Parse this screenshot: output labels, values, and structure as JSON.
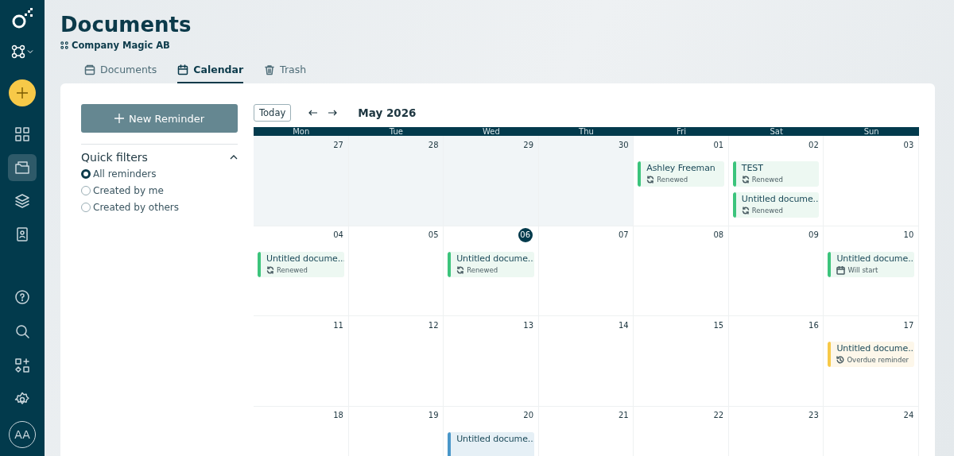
{
  "sidebar": {
    "nav": [
      {
        "kind": "dashboard",
        "selected": false
      },
      {
        "kind": "documents",
        "selected": true
      },
      {
        "kind": "layers",
        "selected": false
      },
      {
        "kind": "contacts",
        "selected": false
      }
    ],
    "bottom": [
      {
        "kind": "help"
      },
      {
        "kind": "search"
      },
      {
        "kind": "apps"
      },
      {
        "kind": "settings"
      }
    ],
    "avatar": "AA"
  },
  "header": {
    "title": "Documents",
    "company": "Company Magic AB"
  },
  "tabs": [
    {
      "label": "Documents",
      "kind": "documents",
      "selected": false
    },
    {
      "label": "Calendar",
      "kind": "calendar",
      "selected": true
    },
    {
      "label": "Trash",
      "kind": "trash",
      "selected": false
    }
  ],
  "left_panel": {
    "new_button": "New Reminder",
    "filters_title": "Quick filters",
    "filters_expanded": true,
    "filters": [
      {
        "label": "All reminders",
        "selected": true
      },
      {
        "label": "Created by me",
        "selected": false
      },
      {
        "label": "Created by others",
        "selected": false
      }
    ]
  },
  "calendar": {
    "today_button": "Today",
    "month": "May 2026",
    "weekdays": [
      "Mon",
      "Tue",
      "Wed",
      "Thu",
      "Fri",
      "Sat",
      "Sun"
    ],
    "weeks": [
      [
        {
          "day": "27",
          "outside_month": true,
          "today": false
        },
        {
          "day": "28",
          "outside_month": true,
          "today": false
        },
        {
          "day": "29",
          "outside_month": true,
          "today": false
        },
        {
          "day": "30",
          "outside_month": true,
          "today": false
        },
        {
          "day": "01",
          "outside_month": false,
          "today": false,
          "events": [
            {
              "title": "Ashley Freeman",
              "kind": "renewed",
              "status": "Renewed",
              "color": "#3cc47c"
            }
          ]
        },
        {
          "day": "02",
          "outside_month": false,
          "today": false,
          "events": [
            {
              "title": "TEST",
              "kind": "renewed",
              "status": "Renewed",
              "color": "#3cc47c"
            },
            {
              "title": "Untitled docume...",
              "kind": "renewed",
              "status": "Renewed",
              "color": "#3cc47c"
            }
          ]
        },
        {
          "day": "03",
          "outside_month": false,
          "today": false
        }
      ],
      [
        {
          "day": "04",
          "outside_month": false,
          "today": false,
          "events": [
            {
              "title": "Untitled docume...",
              "kind": "renewed",
              "status": "Renewed",
              "color": "#3cc47c"
            }
          ]
        },
        {
          "day": "05",
          "outside_month": false,
          "today": false
        },
        {
          "day": "06",
          "outside_month": false,
          "today": true,
          "events": [
            {
              "title": "Untitled docume...",
              "kind": "renewed",
              "status": "Renewed",
              "color": "#3cc47c"
            }
          ]
        },
        {
          "day": "07",
          "outside_month": false,
          "today": false
        },
        {
          "day": "08",
          "outside_month": false,
          "today": false
        },
        {
          "day": "09",
          "outside_month": false,
          "today": false
        },
        {
          "day": "10",
          "outside_month": false,
          "today": false,
          "events": [
            {
              "title": "Untitled docume...",
              "kind": "will_start",
              "status": "Will start",
              "color": "#3cc47c"
            }
          ]
        }
      ],
      [
        {
          "day": "11",
          "outside_month": false,
          "today": false
        },
        {
          "day": "12",
          "outside_month": false,
          "today": false
        },
        {
          "day": "13",
          "outside_month": false,
          "today": false
        },
        {
          "day": "14",
          "outside_month": false,
          "today": false
        },
        {
          "day": "15",
          "outside_month": false,
          "today": false
        },
        {
          "day": "16",
          "outside_month": false,
          "today": false
        },
        {
          "day": "17",
          "outside_month": false,
          "today": false,
          "events": [
            {
              "title": "Untitled docume...",
              "kind": "overdue",
              "status": "Overdue reminder",
              "color": "#f7c948"
            }
          ]
        }
      ],
      [
        {
          "day": "18",
          "outside_month": false,
          "today": false
        },
        {
          "day": "19",
          "outside_month": false,
          "today": false
        },
        {
          "day": "20",
          "outside_month": false,
          "today": false,
          "events": [
            {
              "title": "Untitled docume...",
              "kind": "upcoming",
              "color": "#4a97c9"
            }
          ]
        },
        {
          "day": "21",
          "outside_month": false,
          "today": false
        },
        {
          "day": "22",
          "outside_month": false,
          "today": false
        },
        {
          "day": "23",
          "outside_month": false,
          "today": false
        },
        {
          "day": "24",
          "outside_month": false,
          "today": false
        }
      ]
    ]
  }
}
